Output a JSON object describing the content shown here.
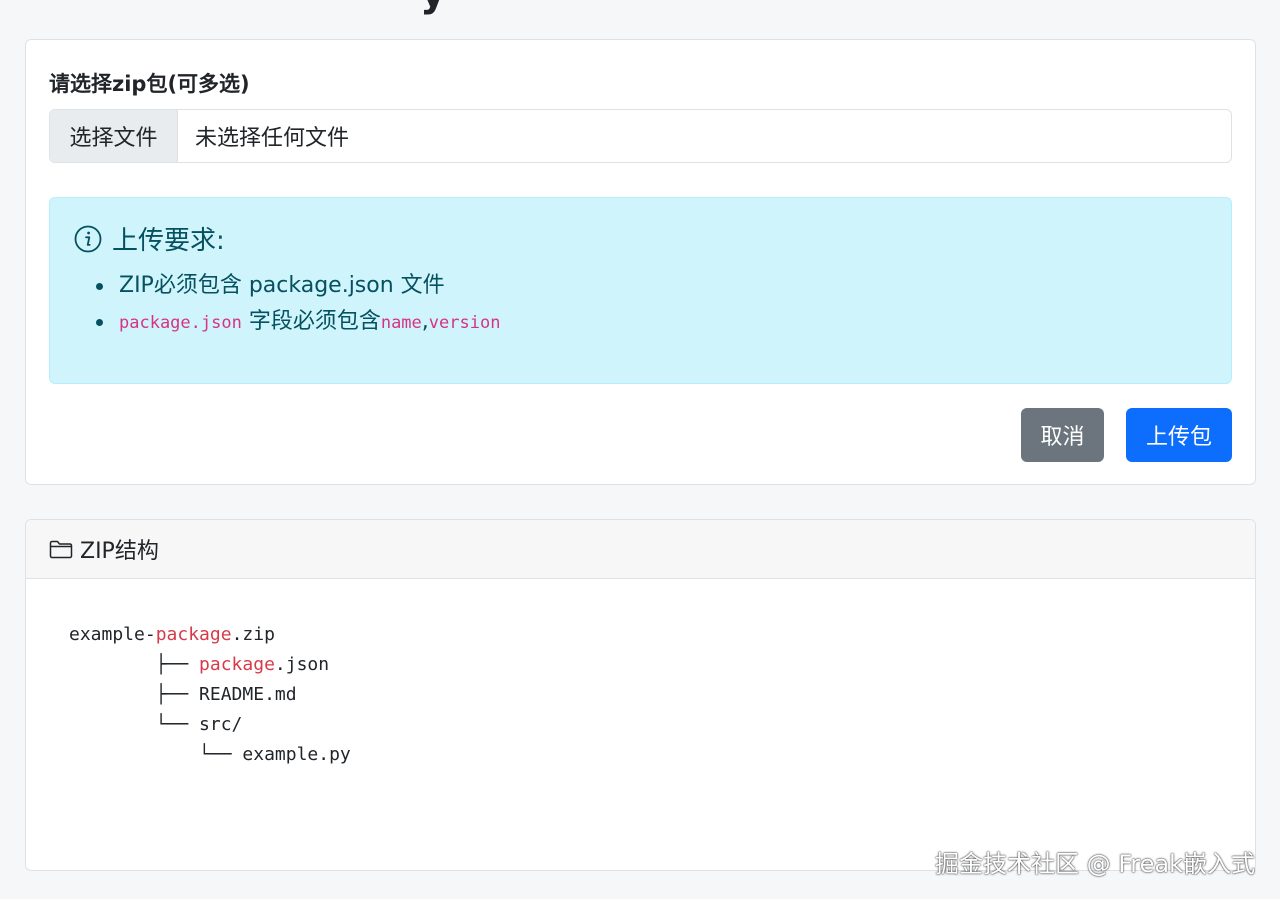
{
  "upload_form": {
    "label": "请选择zip包(可多选)",
    "file_button": "选择文件",
    "file_status": "未选择任何文件"
  },
  "requirements": {
    "icon": "info-circle-icon",
    "title": "上传要求:",
    "item1_text": "ZIP必须包含 package.json 文件",
    "item2_code": "package.json",
    "item2_text": " 字段必须包含",
    "item2_field1": "name",
    "item2_sep": ",",
    "item2_field2": "version"
  },
  "actions": {
    "cancel": "取消",
    "upload": "上传包"
  },
  "zip_structure": {
    "icon": "folder-icon",
    "title": "ZIP结构",
    "tree": {
      "root_prefix": "example-",
      "root_kw": "package",
      "root_suffix": ".zip",
      "line1_branch": "        ├── ",
      "line1_kw": "package",
      "line1_suffix": ".json",
      "line2": "        ├── README.md",
      "line3": "        └── src/",
      "line4": "            └── example.py"
    }
  },
  "watermark": "掘金技术社区 @ Freak嵌入式",
  "colors": {
    "primary": "#0d6efd",
    "secondary": "#6c757d",
    "info_bg": "#cff4fc",
    "info_text": "#055160",
    "code_pink": "#d63384",
    "tree_keyword": "#d73a49"
  }
}
